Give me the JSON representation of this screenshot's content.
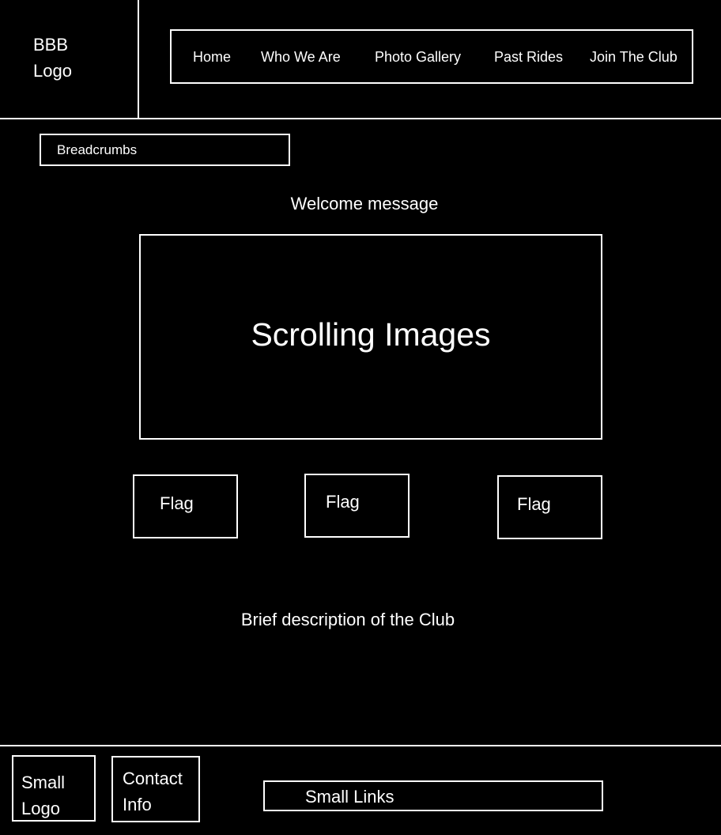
{
  "header": {
    "logo_text": "BBB\nLogo",
    "nav": [
      {
        "label": "Home"
      },
      {
        "label": "Who We Are"
      },
      {
        "label": "Photo Gallery"
      },
      {
        "label": "Past Rides"
      },
      {
        "label": "Join The Club"
      }
    ]
  },
  "breadcrumbs": {
    "label": "Breadcrumbs"
  },
  "main": {
    "welcome": "Welcome message",
    "carousel_label": "Scrolling Images",
    "flags": [
      {
        "label": "Flag"
      },
      {
        "label": "Flag"
      },
      {
        "label": "Flag"
      }
    ],
    "description": "Brief description of the Club"
  },
  "footer": {
    "small_logo": "Small\nLogo",
    "contact": "Contact\nInfo",
    "links": "Small Links"
  }
}
